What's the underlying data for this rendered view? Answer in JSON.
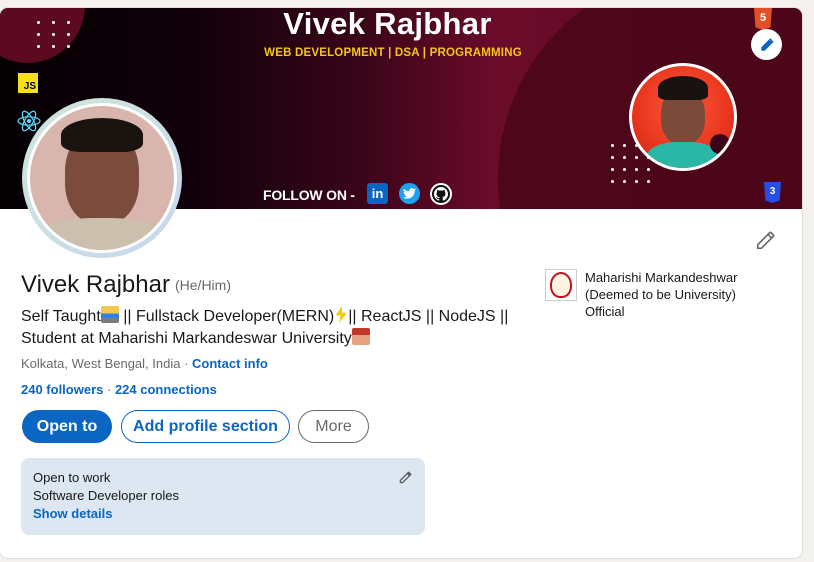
{
  "banner": {
    "title": "Vivek Rajbhar",
    "subtitle": "WEB DEVELOPMENT |  DSA | PROGRAMMING",
    "follow_text": "FOLLOW ON -",
    "js_badge": "JS",
    "html_badge": "5",
    "css_badge": "3",
    "social_icons": [
      "linkedin-icon",
      "twitter-icon",
      "github-icon"
    ]
  },
  "profile": {
    "name": "Vivek Rajbhar",
    "pronouns": "(He/Him)",
    "headline_line1_a": "Self Taught",
    "headline_line1_b": " || Fullstack Developer(MERN)",
    "headline_line1_c": "|| ReactJS || NodeJS ||",
    "headline_line2": "Student at Maharishi Markandeswar University",
    "location": "Kolkata, West Bengal, India",
    "location_sep": " · ",
    "contact_info": "Contact info",
    "followers": "240 followers",
    "stats_sep": " · ",
    "connections": "224 connections"
  },
  "actions": {
    "open_to": "Open to",
    "add_section": "Add profile section",
    "more": "More"
  },
  "open_to_work": {
    "title": "Open to work",
    "roles": "Software Developer roles",
    "link": "Show details"
  },
  "education": {
    "name": "Maharishi Markandeshwar (Deemed to be University) Official"
  },
  "colors": {
    "primary": "#0a66c2",
    "banner_accent": "#f5c518",
    "open_to_work_bg": "#dde7f1"
  }
}
